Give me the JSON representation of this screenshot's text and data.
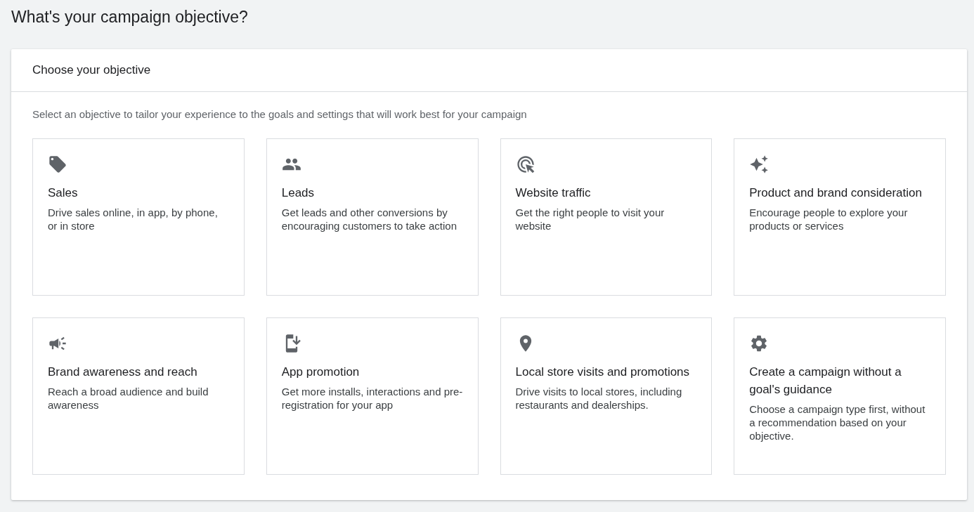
{
  "page": {
    "title": "What's your campaign objective?"
  },
  "card": {
    "title": "Choose your objective",
    "description": "Select an objective to tailor your experience to the goals and settings that will work best for your campaign",
    "objectives": [
      {
        "title": "Sales",
        "description": "Drive sales online, in app, by phone, or in store"
      },
      {
        "title": "Leads",
        "description": "Get leads and other conversions by encouraging customers to take action"
      },
      {
        "title": "Website traffic",
        "description": "Get the right people to visit your website"
      },
      {
        "title": "Product and brand consideration",
        "description": "Encourage people to explore your products or services"
      },
      {
        "title": "Brand awareness and reach",
        "description": "Reach a broad audience and build awareness"
      },
      {
        "title": "App promotion",
        "description": "Get more installs, interactions and pre-registration for your app"
      },
      {
        "title": "Local store visits and promotions",
        "description": "Drive visits to local stores, including restaurants and dealerships."
      },
      {
        "title": "Create a campaign without a goal's guidance",
        "description": "Choose a campaign type first, without a recommendation based on your objective."
      }
    ]
  }
}
